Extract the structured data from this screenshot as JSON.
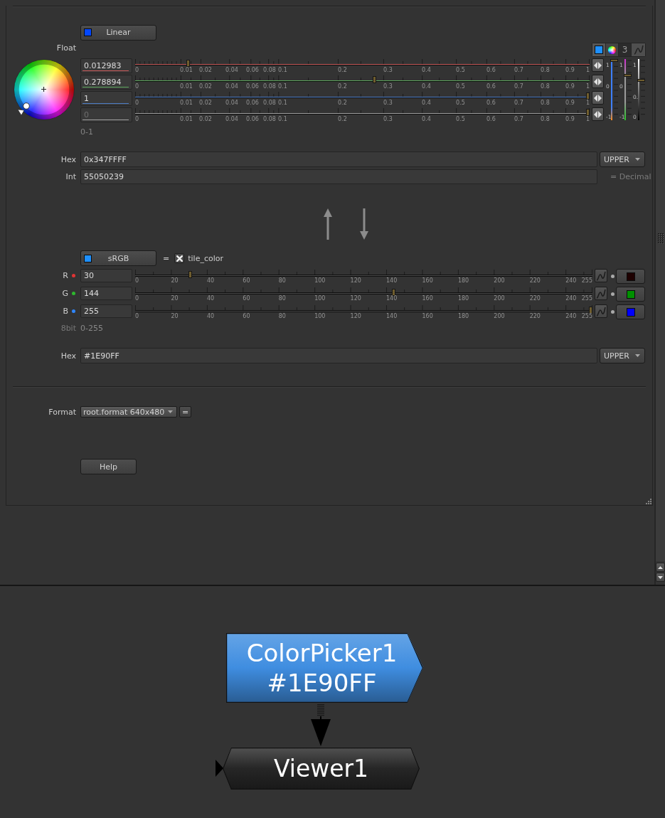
{
  "properties_panel": {
    "linear_section": {
      "colorspace_button": {
        "label": "Linear"
      },
      "mode_label": "Float",
      "toolbar": [
        {
          "kind": "swatch"
        },
        {
          "kind": "wheel"
        },
        {
          "kind": "count",
          "label": "3"
        },
        {
          "kind": "curve"
        }
      ],
      "channels": [
        {
          "value": "0.012983",
          "color": "#c85a5a",
          "level": 0.113,
          "disabled": false,
          "ticks": [
            "0",
            "0.01",
            "0.02",
            "0.04",
            "0.06",
            "0.08",
            "0.1",
            "0.2",
            "0.3",
            "0.4",
            "0.5",
            "0.6",
            "0.7",
            "0.8",
            "0.9",
            "1"
          ]
        },
        {
          "value": "0.278894",
          "color": "#5fa85f",
          "level": 0.526,
          "disabled": false,
          "ticks": [
            "0",
            "0.01",
            "0.02",
            "0.04",
            "0.06",
            "0.08",
            "0.1",
            "0.2",
            "0.3",
            "0.4",
            "0.5",
            "0.6",
            "0.7",
            "0.8",
            "0.9",
            "1"
          ]
        },
        {
          "value": "1",
          "color": "#4f7fc8",
          "level": 1,
          "disabled": false,
          "ticks": [
            "0",
            "0.01",
            "0.02",
            "0.04",
            "0.06",
            "0.08",
            "0.1",
            "0.2",
            "0.3",
            "0.4",
            "0.5",
            "0.6",
            "0.7",
            "0.8",
            "0.9",
            "1"
          ]
        },
        {
          "value": "0",
          "color": "#a0a0a0",
          "level": 1,
          "disabled": true,
          "ticks": [
            "0",
            "0.01",
            "0.02",
            "0.04",
            "0.06",
            "0.08",
            "0.1",
            "0.2",
            "0.3",
            "0.4",
            "0.5",
            "0.6",
            "0.7",
            "0.8",
            "0.9",
            "1"
          ]
        }
      ],
      "vertical_sliders": [
        {
          "labels": [
            "1",
            "0",
            "-1"
          ],
          "level": 1
        },
        {
          "labels": [
            "1",
            "0",
            "-1"
          ],
          "level": 0.74
        },
        {
          "labels": [
            "1",
            "0.",
            "0"
          ],
          "level": 0.66
        }
      ],
      "range_label": "0-1"
    },
    "hex_row": {
      "label": "Hex",
      "value": "0x347FFFF",
      "case_dropdown": "UPPER"
    },
    "int_row": {
      "label": "Int",
      "value": "55050239",
      "note": "= Decimal"
    },
    "srgb_section": {
      "colorspace_button": {
        "label": "sRGB"
      },
      "link_symbol": "=",
      "link_checkbox": {
        "label": "tile_color",
        "checked": true
      },
      "channels": [
        {
          "label": "R",
          "color": "#e03434",
          "value": "30",
          "level": 0.118,
          "ticks": [
            "0",
            "20",
            "40",
            "60",
            "80",
            "100",
            "120",
            "140",
            "160",
            "180",
            "200",
            "220",
            "240",
            "255"
          ]
        },
        {
          "label": "G",
          "color": "#2eb82e",
          "value": "144",
          "level": 0.565,
          "ticks": [
            "0",
            "20",
            "40",
            "60",
            "80",
            "100",
            "120",
            "140",
            "160",
            "180",
            "200",
            "220",
            "240",
            "255"
          ]
        },
        {
          "label": "B",
          "color": "#2f86ff",
          "value": "255",
          "level": 1,
          "ticks": [
            "0",
            "20",
            "40",
            "60",
            "80",
            "100",
            "120",
            "140",
            "160",
            "180",
            "200",
            "220",
            "240",
            "255"
          ]
        }
      ],
      "bit_label": "8bit",
      "range_label": "0-255"
    },
    "hex_row_2": {
      "label": "Hex",
      "value": "#1E90FF",
      "case_dropdown": "UPPER"
    },
    "format_row": {
      "label": "Format",
      "value": "root.format 640x480",
      "link_button": "="
    },
    "help_button": "Help"
  },
  "node_graph": {
    "nodes": [
      {
        "kind": "color_picker",
        "color": "#3f8de0",
        "lines": [
          "ColorPicker1",
          "#1E90FF"
        ]
      },
      {
        "kind": "viewer",
        "color": "#262626",
        "lines": [
          "Viewer1"
        ]
      }
    ]
  }
}
